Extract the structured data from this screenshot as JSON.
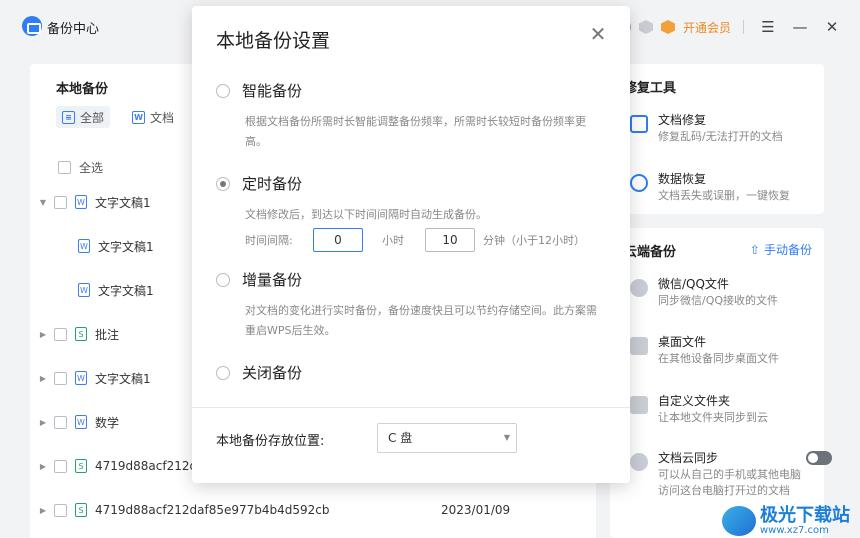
{
  "app": {
    "title": "备份中心"
  },
  "titlebar": {
    "vip_label": "开通会员"
  },
  "local_backup": {
    "title": "本地备份",
    "tabs": [
      {
        "label": "全部",
        "icon": "list-icon"
      },
      {
        "label": "文档",
        "icon": "word-doc-icon"
      }
    ],
    "select_all": "全选",
    "files": [
      {
        "name": "文字文稿1",
        "type": "word",
        "expanded": true,
        "level": 0,
        "date": ""
      },
      {
        "name": "文字文稿1",
        "type": "word",
        "level": 1,
        "date": ""
      },
      {
        "name": "文字文稿1",
        "type": "word",
        "level": 1,
        "date": ""
      },
      {
        "name": "批注",
        "type": "sheet",
        "level": 0,
        "date": ""
      },
      {
        "name": "文字文稿1",
        "type": "word",
        "level": 0,
        "date": ""
      },
      {
        "name": "数学",
        "type": "word",
        "level": 0,
        "date": ""
      },
      {
        "name": "4719d88acf212d",
        "type": "sheet",
        "level": 0,
        "date": ""
      },
      {
        "name": "4719d88acf212daf85e977b4b4d592cb",
        "type": "sheet",
        "level": 0,
        "date": "2023/01/09"
      }
    ]
  },
  "repair_tools": {
    "title": "修复工具",
    "items": [
      {
        "title": "文档修复",
        "subtitle": "修复乱码/无法打开的文档"
      },
      {
        "title": "数据恢复",
        "subtitle": "文档丢失或误删，一键恢复"
      }
    ]
  },
  "cloud_backup": {
    "title": "云端备份",
    "manual_label": "手动备份",
    "items": [
      {
        "title": "微信/QQ文件",
        "subtitle": "同步微信/QQ接收的文件"
      },
      {
        "title": "桌面文件",
        "subtitle": "在其他设备同步桌面文件"
      },
      {
        "title": "自定义文件夹",
        "subtitle": "让本地文件夹同步到云"
      },
      {
        "title": "文档云同步",
        "subtitle": "可以从自己的手机或其他电脑",
        "subtitle2": "访问这台电脑打开过的文档",
        "toggle_on": false
      }
    ]
  },
  "modal": {
    "title": "本地备份设置",
    "options": [
      {
        "label": "智能备份",
        "selected": false,
        "desc": "根据文档备份所需时长智能调整备份频率，所需时长较短时备份频率更高。"
      },
      {
        "label": "定时备份",
        "selected": true,
        "desc": "文档修改后，到达以下时间间隔时自动生成备份。"
      },
      {
        "label": "增量备份",
        "selected": false,
        "desc": "对文档的变化进行实时备份，备份速度快且可以节约存储空间。此方案需重启WPS后生效。"
      },
      {
        "label": "关闭备份",
        "selected": false,
        "desc": ""
      }
    ],
    "interval": {
      "label": "时间间隔:",
      "hours_value": "0",
      "hours_unit": "小时",
      "minutes_value": "10",
      "minutes_unit": "分钟（小于12小时）"
    },
    "location_label": "本地备份存放位置:",
    "location_value": "C 盘"
  },
  "watermark": {
    "text": "极光下载站",
    "url": "www.xz7.com"
  }
}
